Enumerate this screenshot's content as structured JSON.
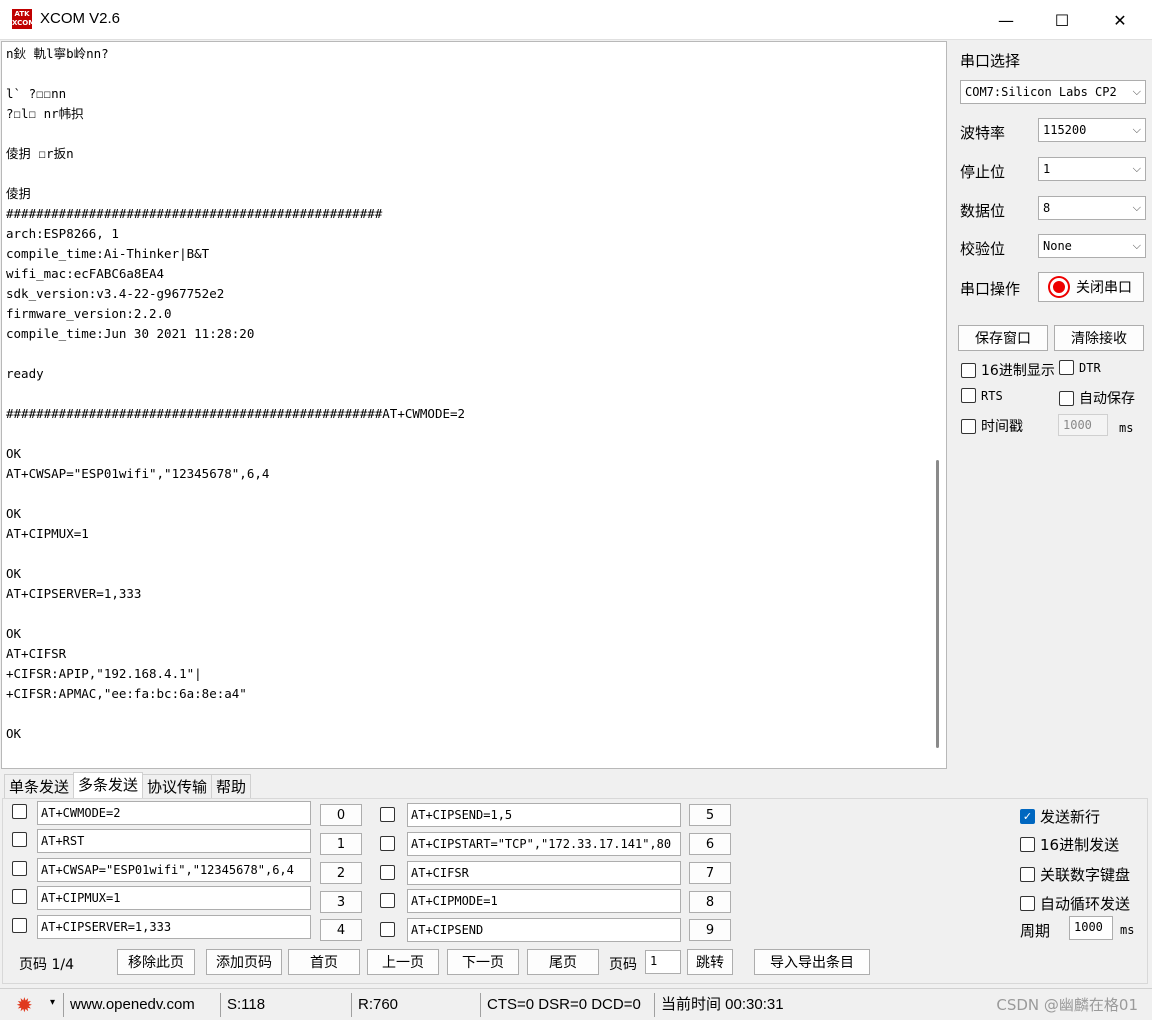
{
  "window": {
    "title": "XCOM V2.6",
    "logo": "ATK XCOM",
    "minimize": "—",
    "maximize": "☐",
    "close": "✕"
  },
  "receive": {
    "lines": [
      "n鈥 軌l寧b岭nn?",
      "",
      "l` ?☐☐nn",
      "?☐l☐ nr帏抧",
      "",
      "倰抈 ☐r扳n",
      "",
      "倰抈",
      "##################################################",
      "arch:ESP8266, 1",
      "compile_time:Ai-Thinker|B&T",
      "wifi_mac:ecFABC6a8EA4",
      "sdk_version:v3.4-22-g967752e2",
      "firmware_version:2.2.0",
      "compile_time:Jun 30 2021 11:28:20",
      "",
      "ready",
      "",
      "##################################################AT+CWMODE=2",
      "",
      "OK",
      "AT+CWSAP=\"ESP01wifi\",\"12345678\",6,4",
      "",
      "OK",
      "AT+CIPMUX=1",
      "",
      "OK",
      "AT+CIPSERVER=1,333",
      "",
      "OK",
      "AT+CIFSR",
      "+CIFSR:APIP,\"192.168.4.1\"|",
      "+CIFSR:APMAC,\"ee:fa:bc:6a:8e:a4\"",
      "",
      "OK"
    ]
  },
  "settings": {
    "port_label": "串口选择",
    "port_value": "COM7:Silicon Labs CP2",
    "baud_label": "波特率",
    "baud_value": "115200",
    "stop_label": "停止位",
    "stop_value": "1",
    "data_label": "数据位",
    "data_value": "8",
    "parity_label": "校验位",
    "parity_value": "None",
    "op_label": "串口操作",
    "op_button": "关闭串口",
    "save_window": "保存窗口",
    "clear_receive": "清除接收",
    "hex_display": "16进制显示",
    "dtr": "DTR",
    "rts": "RTS",
    "auto_save": "自动保存",
    "timestamp": "时间戳",
    "timestamp_value": "1000",
    "timestamp_unit": "ms"
  },
  "tabs": [
    "单条发送",
    "多条发送",
    "协议传输",
    "帮助"
  ],
  "multi_send": {
    "left": [
      {
        "cmd": "AT+CWMODE=2",
        "num": "0"
      },
      {
        "cmd": "AT+RST",
        "num": "1"
      },
      {
        "cmd": "AT+CWSAP=\"ESP01wifi\",\"12345678\",6,4",
        "num": "2"
      },
      {
        "cmd": "AT+CIPMUX=1",
        "num": "3"
      },
      {
        "cmd": "AT+CIPSERVER=1,333",
        "num": "4"
      }
    ],
    "right": [
      {
        "cmd": "AT+CIPSEND=1,5",
        "num": "5"
      },
      {
        "cmd": "AT+CIPSTART=\"TCP\",\"172.33.17.141\",80",
        "num": "6"
      },
      {
        "cmd": "AT+CIFSR",
        "num": "7"
      },
      {
        "cmd": "AT+CIPMODE=1",
        "num": "8"
      },
      {
        "cmd": "AT+CIPSEND",
        "num": "9"
      }
    ],
    "send_newline": "发送新行",
    "hex_send": "16进制发送",
    "link_keypad": "关联数字键盘",
    "auto_loop": "自动循环发送",
    "period_label": "周期",
    "period_value": "1000",
    "period_unit": "ms"
  },
  "pager": {
    "page_info": "页码 1/4",
    "remove_page": "移除此页",
    "add_page": "添加页码",
    "first": "首页",
    "prev": "上一页",
    "next": "下一页",
    "last": "尾页",
    "page_label": "页码",
    "page_value": "1",
    "jump": "跳转",
    "import_export": "导入导出条目"
  },
  "status": {
    "website": "www.openedv.com",
    "sent": "S:118",
    "received": "R:760",
    "signals": "CTS=0 DSR=0 DCD=0",
    "time": "当前时间 00:30:31",
    "watermark": "CSDN @幽麟在格01"
  },
  "colors": {
    "accent": "#0067c0",
    "logo": "#c00000",
    "gear": "#e03a1e"
  }
}
